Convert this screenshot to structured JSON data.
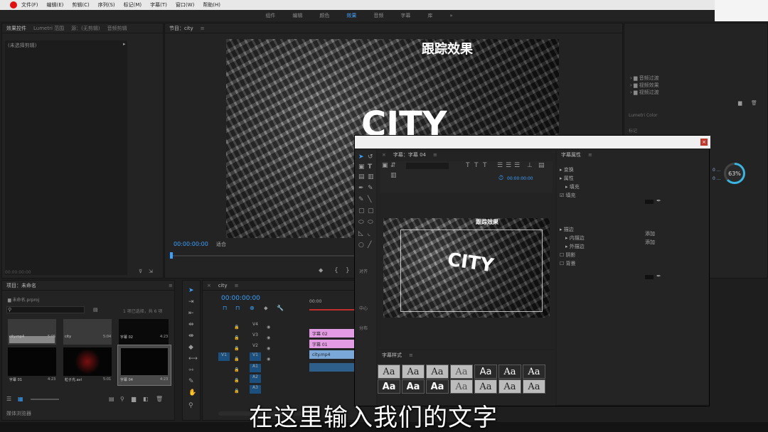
{
  "menubar": {
    "items": [
      "文件(F)",
      "编辑(E)",
      "剪辑(C)",
      "序列(S)",
      "标记(M)",
      "字幕(T)",
      "窗口(W)",
      "帮助(H)"
    ]
  },
  "workspaces": {
    "items": [
      "组件",
      "编辑",
      "颜色",
      "效果",
      "音频",
      "字幕",
      "库"
    ],
    "active": "效果"
  },
  "left_panel": {
    "tabs": [
      "效果控件",
      "Lumetri 范围",
      "源：(无剪辑)",
      "音频剪辑"
    ],
    "no_clip": "(未选择剪辑)",
    "timecode": "00:00:00:00"
  },
  "program": {
    "tab": "节目：city",
    "timecode": "00:00:00:00",
    "fit": "适合",
    "overlay_title": "跟踪效果",
    "overlay_city": "CITY"
  },
  "project": {
    "tab": "项目：未命名",
    "file": "未命名.prproj",
    "selection": "1 项已选择，共 6 项",
    "items": [
      {
        "name": "city.mp4",
        "dur": "5:05"
      },
      {
        "name": "city",
        "dur": "5:04"
      },
      {
        "name": "字幕 02",
        "dur": "4:23"
      },
      {
        "name": "字幕 01",
        "dur": "4:23"
      },
      {
        "name": "粒子光.avi",
        "dur": "5:01"
      },
      {
        "name": "字幕 04",
        "dur": "4:23"
      }
    ],
    "browser": "媒体浏览器"
  },
  "timeline": {
    "tab": "city",
    "timecode": "00:00:00:00",
    "ruler": "00:00",
    "tracks": [
      "V4",
      "V3",
      "V2",
      "V1",
      "A1",
      "A2",
      "A3"
    ],
    "clips": [
      "字幕 02",
      "字幕 01",
      "city.mp4"
    ]
  },
  "right_panel": {
    "tree": [
      "音频过渡",
      "视频效果",
      "视频过渡"
    ],
    "lumetri": "Lumetri Color",
    "marker": "标记"
  },
  "title_dialog": {
    "tab": "字幕：字幕 04",
    "timecode": "00:00:00:00",
    "preview_text": "CITY",
    "preview_title": "跟踪效果",
    "props_tab": "字幕属性",
    "props": [
      "变换",
      "属性",
      "填充",
      "描边",
      "内描边",
      "外描边",
      "阴影",
      "背景"
    ],
    "props_fill_sub": "填充",
    "align_label": "对齐",
    "center_label": "中心",
    "distribute_label": "分布",
    "styles_tab": "字幕样式",
    "style_sample": "Aa",
    "stroke_values": [
      "0 ...",
      "0 ..."
    ]
  },
  "progress_ring": {
    "value": "63%",
    "percent": 63
  },
  "subtitle": "在这里输入我们的文字"
}
